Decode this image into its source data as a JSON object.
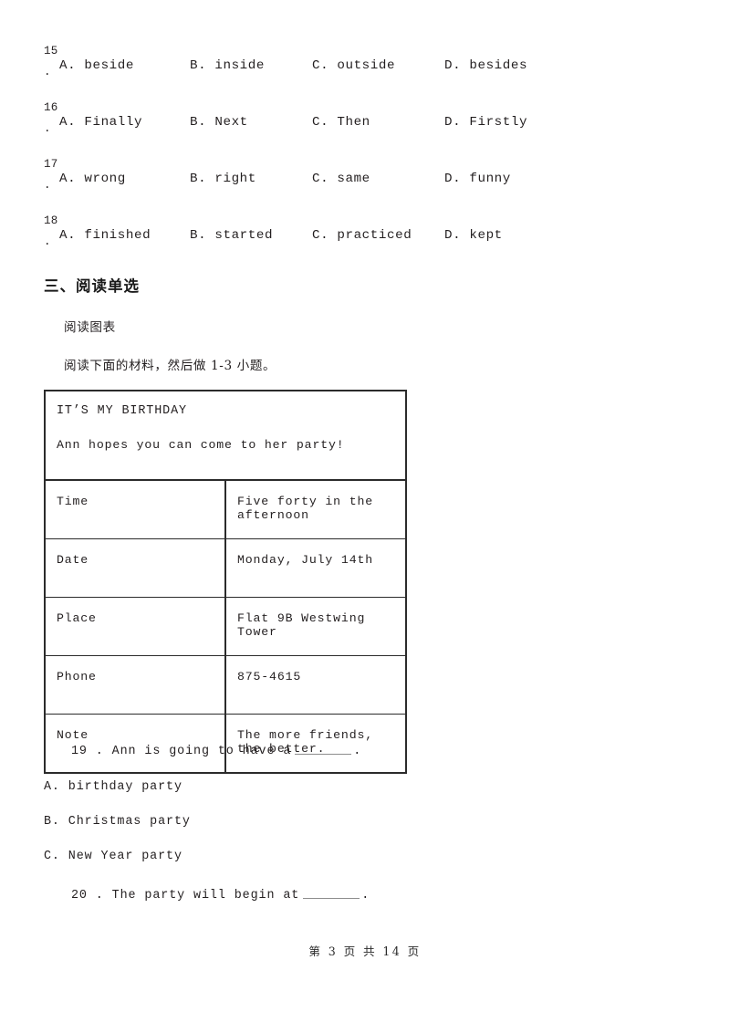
{
  "cloze_questions": [
    {
      "number": "15",
      "punct": ".",
      "options": [
        "A. beside",
        "B. inside",
        "C. outside",
        "D. besides"
      ]
    },
    {
      "number": "16",
      "punct": ".",
      "options": [
        "A. Finally",
        "B. Next",
        "C. Then",
        "D. Firstly"
      ]
    },
    {
      "number": "17",
      "punct": ".",
      "options": [
        "A. wrong",
        "B. right",
        "C. same",
        "D. funny"
      ]
    },
    {
      "number": "18",
      "punct": ".",
      "options": [
        "A. finished",
        "B. started",
        "C. practiced",
        "D. kept"
      ]
    }
  ],
  "section": {
    "heading": "三、阅读单选",
    "subheading": "阅读图表",
    "instruction": "阅读下面的材料，然后做 1-3 小题。"
  },
  "info_table": {
    "header_title": "IT’S MY BIRTHDAY",
    "header_subtitle": "Ann hopes you can come to her party!",
    "rows": [
      {
        "label": "Time",
        "value": "Five forty in the afternoon"
      },
      {
        "label": "Date",
        "value": "Monday, July 14th"
      },
      {
        "label": "Place",
        "value": "Flat 9B Westwing Tower"
      },
      {
        "label": "Phone",
        "value": "875-4615"
      },
      {
        "label": "Note",
        "value": "The more friends, the better."
      }
    ]
  },
  "reading_questions": [
    {
      "number": "19",
      "stem_before": "19 . Ann is going to have a",
      "stem_after": ".",
      "options": [
        "A. birthday party",
        "B. Christmas party",
        "C. New Year party"
      ]
    },
    {
      "number": "20",
      "stem_before": "20 . The party will begin at",
      "stem_after": ".",
      "options": []
    }
  ],
  "footer": {
    "text": "第 3 页 共 14 页"
  }
}
